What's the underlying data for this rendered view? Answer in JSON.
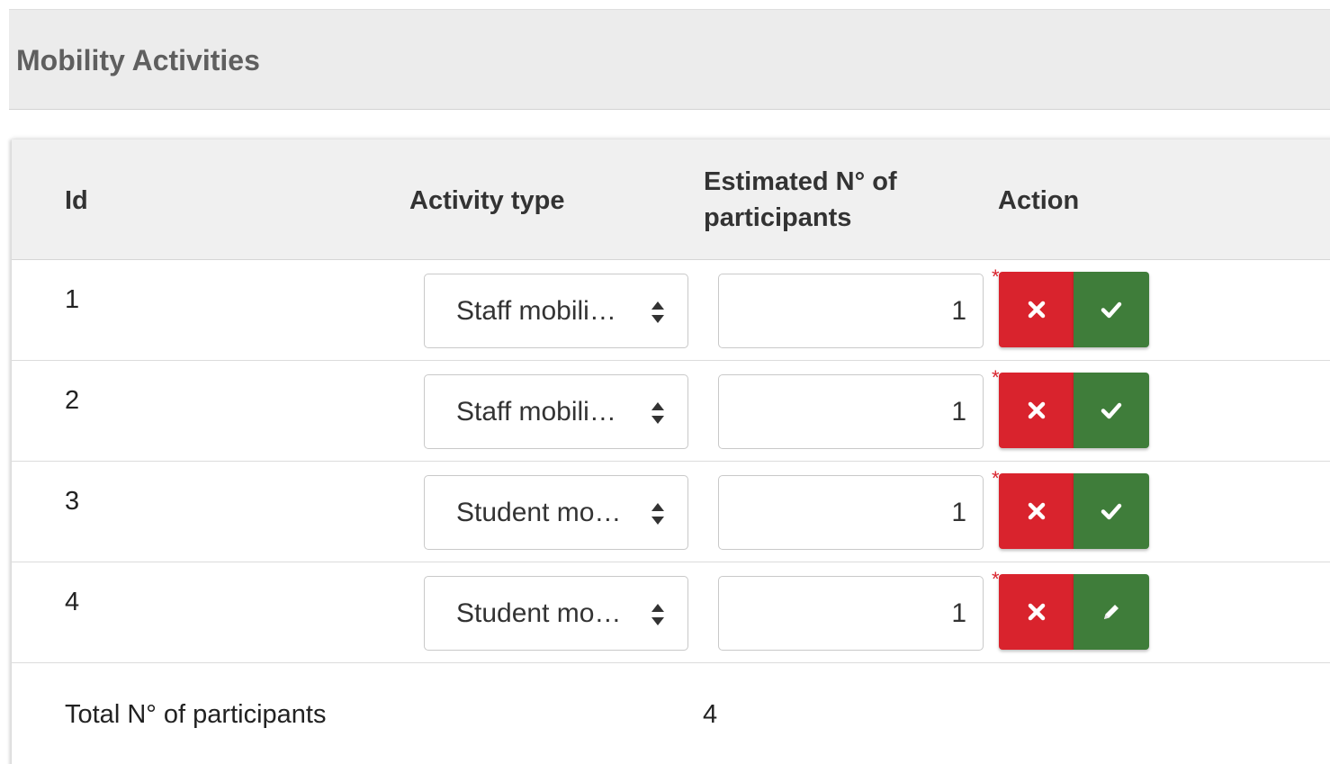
{
  "section": {
    "title": "Mobility Activities"
  },
  "table": {
    "headers": {
      "id": "Id",
      "activity_type": "Activity type",
      "participants_line1": "Estimated N° of",
      "participants_line2": "participants",
      "action": "Action"
    },
    "rows": [
      {
        "id": "1",
        "activity_type": "Staff mobili…",
        "participants": "1",
        "required_mark": "*",
        "confirm_icon": "check-icon"
      },
      {
        "id": "2",
        "activity_type": "Staff mobili…",
        "participants": "1",
        "required_mark": "*",
        "confirm_icon": "check-icon"
      },
      {
        "id": "3",
        "activity_type": "Student mo…",
        "participants": "1",
        "required_mark": "*",
        "confirm_icon": "check-icon"
      },
      {
        "id": "4",
        "activity_type": "Student mo…",
        "participants": "1",
        "required_mark": "*",
        "confirm_icon": "pencil-icon"
      }
    ],
    "total": {
      "label": "Total N° of participants",
      "value": "4"
    }
  },
  "colors": {
    "delete": "#d9232d",
    "confirm": "#3f7d3a",
    "header_bg": "#ececec",
    "table_header_bg": "#f0f0f0"
  }
}
